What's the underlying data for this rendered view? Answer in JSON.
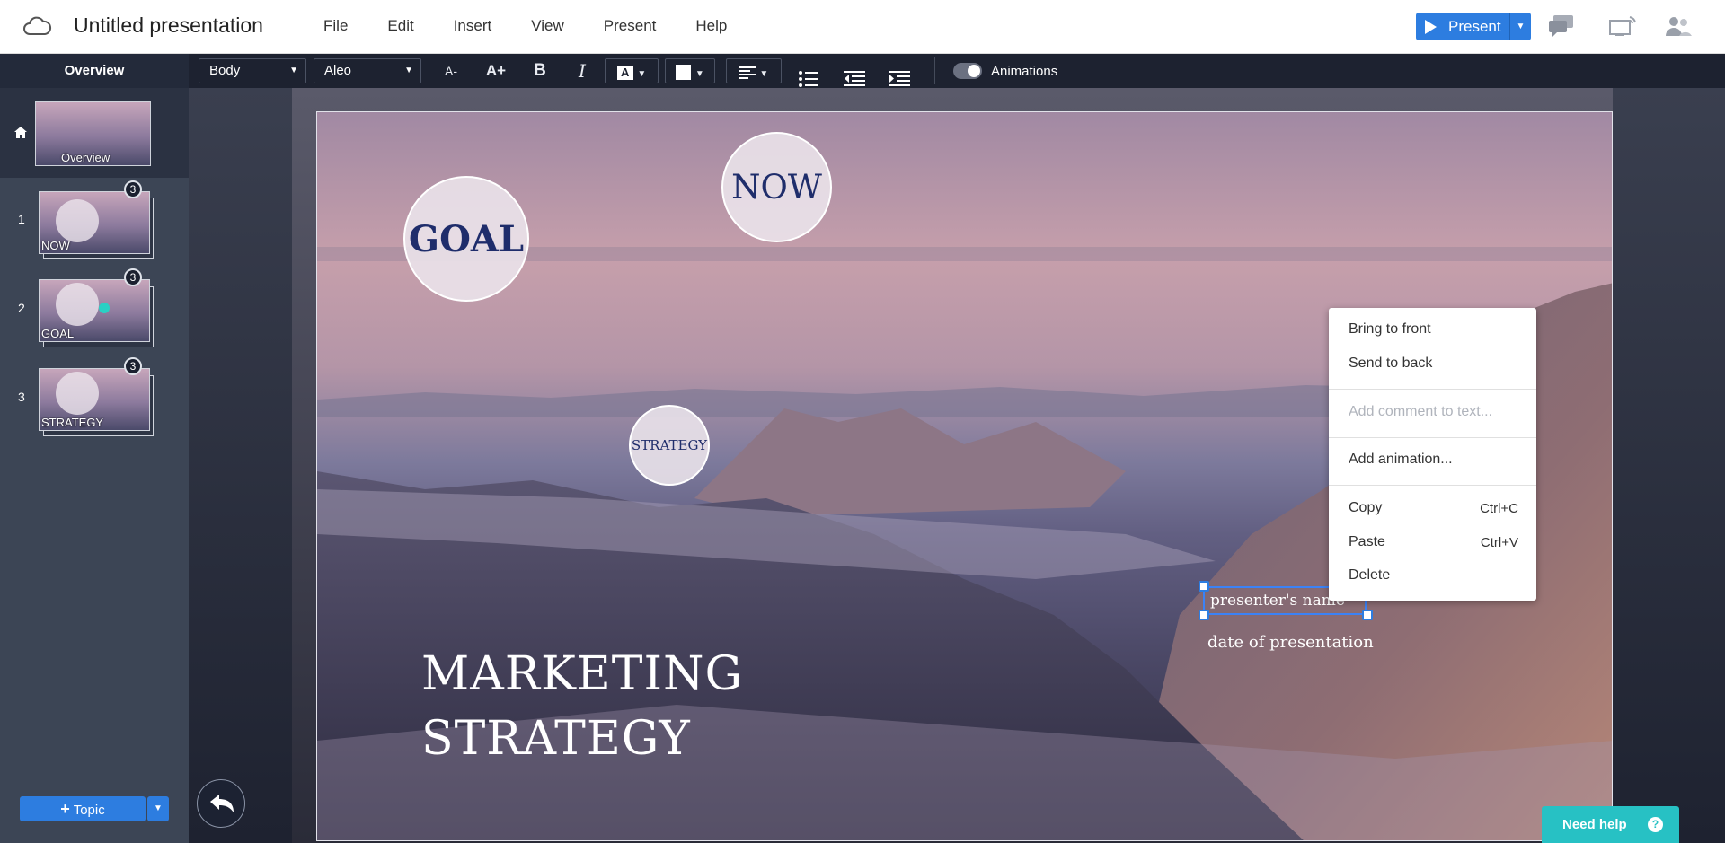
{
  "app": {
    "title": "Untitled presentation"
  },
  "menu": {
    "items": [
      "File",
      "Edit",
      "Insert",
      "View",
      "Present",
      "Help"
    ]
  },
  "present_button": {
    "label": "Present"
  },
  "toolbar": {
    "overview_label": "Overview",
    "style_select": "Body",
    "font_select": "Aleo",
    "decrease_font": "A-",
    "increase_font": "A+",
    "bold": "B",
    "italic": "I",
    "text_color_glyph": "A",
    "animations_label": "Animations",
    "animations_enabled": true
  },
  "sidebar": {
    "overview_caption": "Overview",
    "slides": [
      {
        "number": "1",
        "caption": "NOW",
        "badge": "3"
      },
      {
        "number": "2",
        "caption": "GOAL",
        "badge": "3"
      },
      {
        "number": "3",
        "caption": "STRATEGY",
        "badge": "3"
      }
    ],
    "topic_button": "Topic"
  },
  "slide": {
    "goal": "GOAL",
    "now": "NOW",
    "strategy": "STRATEGY",
    "title_line1": "MARKETING",
    "title_line2": "STRATEGY",
    "presenter": "presenter's name",
    "date": "date of presentation"
  },
  "context_menu": {
    "bring_front": "Bring to front",
    "send_back": "Send to back",
    "add_comment": "Add comment to text...",
    "add_animation": "Add animation...",
    "copy": "Copy",
    "copy_shortcut": "Ctrl+C",
    "paste": "Paste",
    "paste_shortcut": "Ctrl+V",
    "delete": "Delete"
  },
  "help": {
    "label": "Need help",
    "q": "?"
  },
  "colors": {
    "accent": "#2d7de0",
    "help": "#27c1c4",
    "circle_text": "#1f2d6b"
  }
}
